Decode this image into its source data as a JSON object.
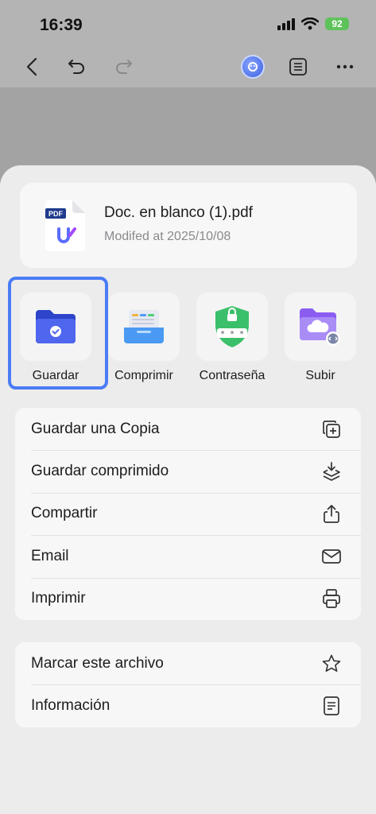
{
  "status_bar": {
    "time": "16:39",
    "battery": "92"
  },
  "file": {
    "name": "Doc. en blanco (1).pdf",
    "modified": "Modifed at 2025/10/08",
    "badge": "PDF"
  },
  "actions": [
    {
      "label": "Guardar",
      "icon": "folder-check-icon"
    },
    {
      "label": "Comprimir",
      "icon": "compress-tray-icon"
    },
    {
      "label": "Contraseña",
      "icon": "password-shield-icon"
    },
    {
      "label": "Subir",
      "icon": "cloud-upload-folder-icon"
    }
  ],
  "menu_group_1": [
    {
      "label": "Guardar una Copia",
      "icon": "copy-add-icon"
    },
    {
      "label": "Guardar comprimido",
      "icon": "layers-download-icon"
    },
    {
      "label": "Compartir",
      "icon": "share-icon"
    },
    {
      "label": "Email",
      "icon": "mail-icon"
    },
    {
      "label": "Imprimir",
      "icon": "printer-icon"
    }
  ],
  "menu_group_2": [
    {
      "label": "Marcar este archivo",
      "icon": "star-icon"
    },
    {
      "label": "Información",
      "icon": "info-doc-icon"
    }
  ],
  "colors": {
    "accent": "#4a7cf5",
    "sheet": "#ececec",
    "card": "#f7f7f7"
  }
}
